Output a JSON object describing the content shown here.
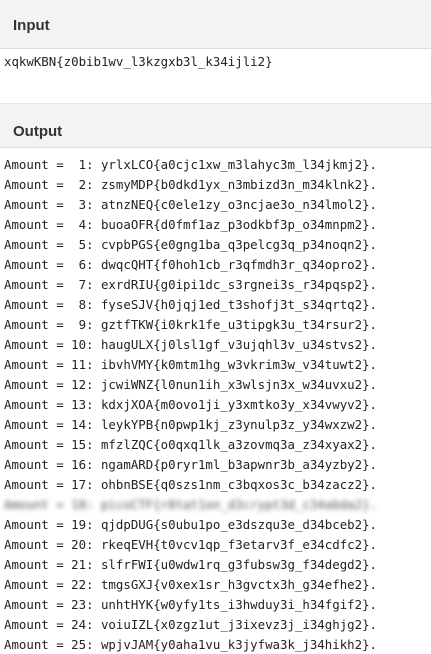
{
  "input": {
    "title": "Input",
    "value": "xqkwKBN{z0bib1wv_l3kzgxb3l_k34ijli2}"
  },
  "output": {
    "title": "Output",
    "lines": [
      {
        "text": "Amount =  1: yrlxLCO{a0cjc1xw_m3lahyc3m_l34jkmj2}.",
        "blurred": false
      },
      {
        "text": "Amount =  2: zsmyMDP{b0dkd1yx_n3mbizd3n_m34klnk2}.",
        "blurred": false
      },
      {
        "text": "Amount =  3: atnzNEQ{c0ele1zy_o3ncjae3o_n34lmol2}.",
        "blurred": false
      },
      {
        "text": "Amount =  4: buoaOFR{d0fmf1az_p3odkbf3p_o34mnpm2}.",
        "blurred": false
      },
      {
        "text": "Amount =  5: cvpbPGS{e0gng1ba_q3pelcg3q_p34noqn2}.",
        "blurred": false
      },
      {
        "text": "Amount =  6: dwqcQHT{f0hoh1cb_r3qfmdh3r_q34opro2}.",
        "blurred": false
      },
      {
        "text": "Amount =  7: exrdRIU{g0ipi1dc_s3rgnei3s_r34pqsp2}.",
        "blurred": false
      },
      {
        "text": "Amount =  8: fyseSJV{h0jqj1ed_t3shofj3t_s34qrtq2}.",
        "blurred": false
      },
      {
        "text": "Amount =  9: gztfTKW{i0krk1fe_u3tipgk3u_t34rsur2}.",
        "blurred": false
      },
      {
        "text": "Amount = 10: haugULX{j0lsl1gf_v3ujqhl3v_u34stvs2}.",
        "blurred": false
      },
      {
        "text": "Amount = 11: ibvhVMY{k0mtm1hg_w3vkrim3w_v34tuwt2}.",
        "blurred": false
      },
      {
        "text": "Amount = 12: jcwiWNZ{l0nun1ih_x3wlsjn3x_w34uvxu2}.",
        "blurred": false
      },
      {
        "text": "Amount = 13: kdxjXOA{m0ovo1ji_y3xmtko3y_x34vwyv2}.",
        "blurred": false
      },
      {
        "text": "Amount = 14: leykYPB{n0pwp1kj_z3ynulp3z_y34wxzw2}.",
        "blurred": false
      },
      {
        "text": "Amount = 15: mfzlZQC{o0qxq1lk_a3zovmq3a_z34xyax2}.",
        "blurred": false
      },
      {
        "text": "Amount = 16: ngamARD{p0ryr1ml_b3apwnr3b_a34yzby2}.",
        "blurred": false
      },
      {
        "text": "Amount = 17: ohbnBSE{q0szs1nm_c3bqxos3c_b34zacz2}.",
        "blurred": false
      },
      {
        "text": "Amount = 18: picoCTF{r0tat1on_d3crypt3d_c34abda2}.",
        "blurred": true
      },
      {
        "text": "Amount = 19: qjdpDUG{s0ubu1po_e3dszqu3e_d34bceb2}.",
        "blurred": false
      },
      {
        "text": "Amount = 20: rkeqEVH{t0vcv1qp_f3etarv3f_e34cdfc2}.",
        "blurred": false
      },
      {
        "text": "Amount = 21: slfrFWI{u0wdw1rq_g3fubsw3g_f34degd2}.",
        "blurred": false
      },
      {
        "text": "Amount = 22: tmgsGXJ{v0xex1sr_h3gvctx3h_g34efhe2}.",
        "blurred": false
      },
      {
        "text": "Amount = 23: unhtHYK{w0yfy1ts_i3hwduy3i_h34fgif2}.",
        "blurred": false
      },
      {
        "text": "Amount = 24: voiuIZL{x0zgz1ut_j3ixevz3j_i34ghjg2}.",
        "blurred": false
      },
      {
        "text": "Amount = 25: wpjvJAM{y0aha1vu_k3jyfwa3k_j34hikh2}.",
        "blurred": false
      }
    ]
  }
}
